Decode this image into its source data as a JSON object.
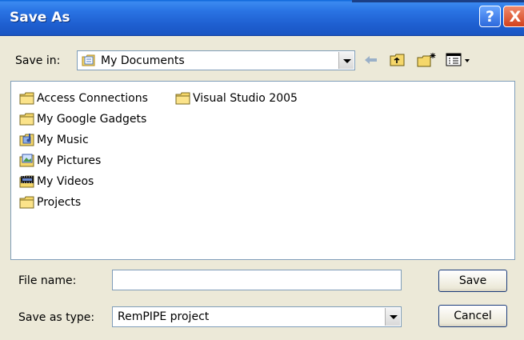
{
  "window": {
    "title": "Save As",
    "help_symbol": "?",
    "close_symbol": "X"
  },
  "toolbar": {
    "save_in_label": "Save in:",
    "save_in_value": "My Documents",
    "icons": [
      "back-arrow-icon",
      "up-folder-icon",
      "new-folder-icon",
      "view-menu-icon"
    ]
  },
  "files": {
    "items": [
      {
        "label": "Access Connections",
        "icon": "folder-icon"
      },
      {
        "label": "Visual Studio 2005",
        "icon": "folder-icon"
      },
      {
        "label": "My Google Gadgets",
        "icon": "folder-icon"
      },
      {
        "label": "My Music",
        "icon": "music-folder-icon"
      },
      {
        "label": "My Pictures",
        "icon": "pictures-folder-icon"
      },
      {
        "label": "My Videos",
        "icon": "videos-folder-icon"
      },
      {
        "label": "Projects",
        "icon": "folder-icon"
      }
    ]
  },
  "form": {
    "file_name_label": "File name:",
    "file_name_value": "",
    "type_label": "Save as type:",
    "type_value": "RemPIPE project",
    "save_label": "Save",
    "cancel_label": "Cancel"
  }
}
